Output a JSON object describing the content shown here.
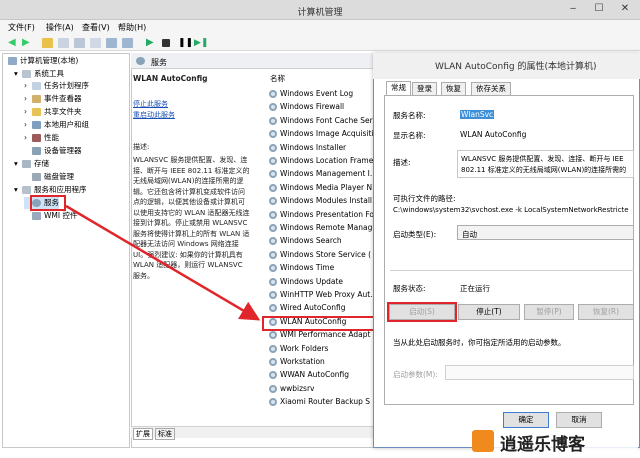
{
  "window": {
    "title": "计算机管理"
  },
  "menu": [
    "文件(F)",
    "操作(A)",
    "查看(V)",
    "帮助(H)"
  ],
  "tree": {
    "root": "计算机管理(本地)",
    "system_tools": "系统工具",
    "task_scheduler": "任务计划程序",
    "event_viewer": "事件查看器",
    "shared_folders": "共享文件夹",
    "local_users": "本地用户和组",
    "performance": "性能",
    "device_manager": "设备管理器",
    "storage": "存储",
    "disk_mgmt": "磁盘管理",
    "services_apps": "服务和应用程序",
    "services": "服务",
    "wmi": "WMI 控件"
  },
  "panel": {
    "header": "服务",
    "selected_name": "WLAN AutoConfig",
    "link_stop": "停止此服务",
    "link_restart": "重启动此服务",
    "desc_label": "描述:",
    "desc_lines": [
      "WLANSVC 服务提供配置、发现、连",
      "接、断开与 IEEE 802.11 标准定义的",
      "无线局域网(WLAN)的连接所需的逻",
      "辑。它还包含将计算机变成软件访问",
      "点的逻辑，以便其他设备或计算机可",
      "以使用支持它的 WLAN 适配器无线连",
      "接到计算机。停止或禁用 WLANSVC",
      "服务将使得计算机上的所有 WLAN 适",
      "配器无法访问 Windows 网络连接",
      "UI。强烈建议: 如果你的计算机具有",
      "WLAN 适配器，则运行 WLANSVC",
      "服务。"
    ],
    "col_name": "名称",
    "services": [
      "Windows Event Log",
      "Windows Firewall",
      "Windows Font Cache Ser",
      "Windows Image Acquisiti",
      "Windows Installer",
      "Windows Location Frame",
      "Windows Management I.",
      "Windows Media Player N",
      "Windows Modules Install",
      "Windows Presentation Fo",
      "Windows Remote Manag",
      "Windows Search",
      "Windows Store Service (",
      "Windows Time",
      "Windows Update",
      "WinHTTP Web Proxy Aut.",
      "Wired AutoConfig",
      "WLAN AutoConfig",
      "WMI Performance Adapt",
      "Work Folders",
      "Workstation",
      "WWAN AutoConfig",
      "wwbizsrv",
      "Xiaomi Router Backup S"
    ],
    "tab_ext": "扩展",
    "tab_std": "标准"
  },
  "dialog": {
    "title": "WLAN AutoConfig 的属性(本地计算机)",
    "tabs": [
      "常规",
      "登录",
      "恢复",
      "依存关系"
    ],
    "svc_name_label": "服务名称:",
    "svc_name": "WlanSvc",
    "display_label": "显示名称:",
    "display": "WLAN AutoConfig",
    "desc_label": "描述:",
    "desc_lines": [
      "WLANSVC 服务提供配置、发现、连接、断开与 IEE",
      "802.11 标准定义的无线局域网(WLAN)的连接所需的"
    ],
    "path_label": "可执行文件的路径:",
    "path": "C:\\windows\\system32\\svchost.exe -k LocalSystemNetworkRestricte",
    "startup_label": "启动类型(E):",
    "startup": "自动",
    "status_label": "服务状态:",
    "status": "正在运行",
    "btn_start": "启动(S)",
    "btn_stop": "停止(T)",
    "btn_pause": "暂停(P)",
    "btn_resume": "恢复(R)",
    "hint": "当从此处启动服务时，你可指定所适用的启动参数。",
    "params_label": "启动参数(M):",
    "ok": "确定",
    "cancel": "取消"
  },
  "watermark": "逍遥乐博客"
}
